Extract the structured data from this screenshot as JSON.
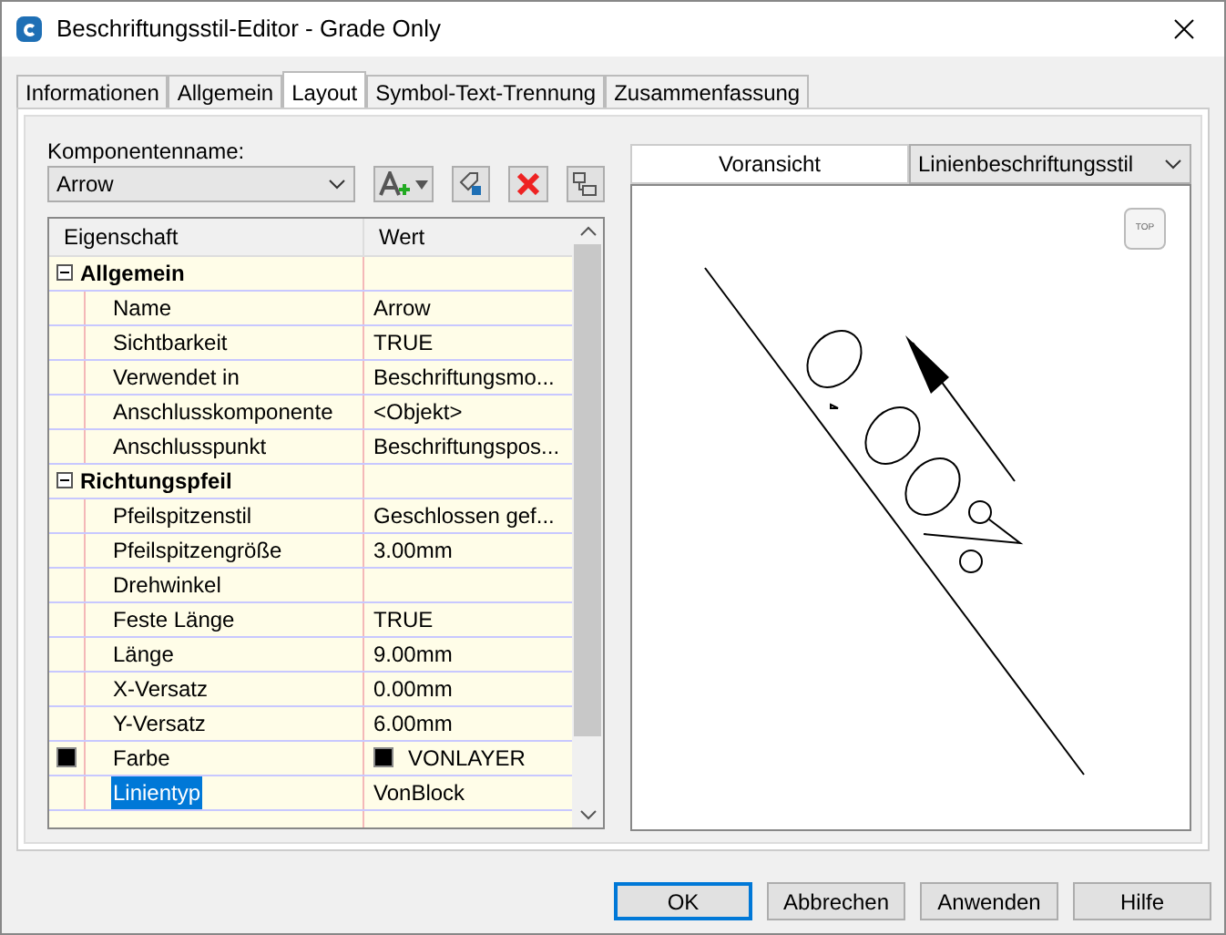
{
  "window": {
    "title": "Beschriftungsstil-Editor - Grade Only"
  },
  "tabs": [
    {
      "label": "Informationen",
      "selected": false
    },
    {
      "label": "Allgemein",
      "selected": false
    },
    {
      "label": "Layout",
      "selected": true
    },
    {
      "label": "Symbol-Text-Trennung",
      "selected": false
    },
    {
      "label": "Zusammenfassung",
      "selected": false
    }
  ],
  "component": {
    "label": "Komponentenname:",
    "value": "Arrow"
  },
  "grid": {
    "columns": [
      "Eigenschaft",
      "Wert"
    ],
    "rows": [
      {
        "kind": "group",
        "name": "Allgemein",
        "expanded": true
      },
      {
        "kind": "property",
        "name": "Name",
        "value": "Arrow",
        "selected": false
      },
      {
        "kind": "property",
        "name": "Sichtbarkeit",
        "value": "TRUE",
        "selected": false
      },
      {
        "kind": "property",
        "name": "Verwendet in",
        "value": "Beschriftungsmo...",
        "selected": false
      },
      {
        "kind": "property",
        "name": "Anschlusskomponente",
        "value": "<Objekt>",
        "selected": false
      },
      {
        "kind": "property",
        "name": "Anschlusspunkt",
        "value": "Beschriftungspos...",
        "selected": false
      },
      {
        "kind": "group",
        "name": "Richtungspfeil",
        "expanded": true
      },
      {
        "kind": "property",
        "name": "Pfeilspitzenstil",
        "value": "Geschlossen gef...",
        "selected": false
      },
      {
        "kind": "property",
        "name": "Pfeilspitzengröße",
        "value": "3.00mm",
        "selected": false
      },
      {
        "kind": "property",
        "name": "Drehwinkel",
        "selected": false
      },
      {
        "kind": "property",
        "name": "Feste Länge",
        "value": "TRUE",
        "selected": false
      },
      {
        "kind": "property",
        "name": "Länge",
        "value": "9.00mm",
        "selected": false
      },
      {
        "kind": "property",
        "name": "X-Versatz",
        "value": "0.00mm",
        "selected": false
      },
      {
        "kind": "property",
        "name": "Y-Versatz",
        "value": "6.00mm",
        "selected": false
      },
      {
        "kind": "property",
        "name": "Farbe",
        "value": "VONLAYER",
        "color": "#000000",
        "selected": false
      },
      {
        "kind": "property",
        "name": "Linientyp",
        "value": "VonBlock",
        "selected": true
      }
    ]
  },
  "preview": {
    "label": "Voransicht",
    "style": "Linienbeschriftungsstil",
    "view_button": "TOP"
  },
  "buttons": [
    {
      "label": "OK",
      "default": true
    },
    {
      "label": "Abbrechen",
      "default": false
    },
    {
      "label": "Anwenden",
      "default": false
    },
    {
      "label": "Hilfe",
      "default": false
    }
  ]
}
